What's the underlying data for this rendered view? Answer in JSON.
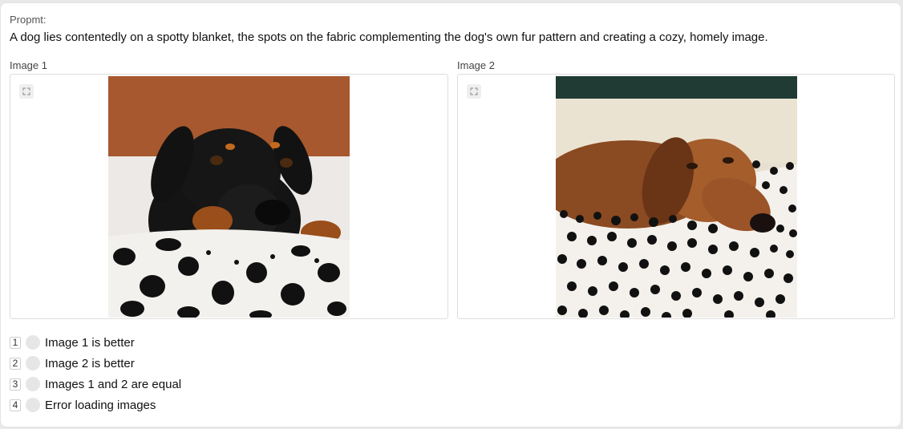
{
  "prompt": {
    "label": "Propmt:",
    "text": "A dog lies contentedly on a spotty blanket, the spots on the fabric complementing the dog's own fur pattern and creating a cozy, homely image."
  },
  "images": [
    {
      "label": "Image 1"
    },
    {
      "label": "Image 2"
    }
  ],
  "options": [
    {
      "key": "1",
      "label": "Image 1 is better"
    },
    {
      "key": "2",
      "label": "Image 2 is better"
    },
    {
      "key": "3",
      "label": "Images 1 and 2 are equal"
    },
    {
      "key": "4",
      "label": "Error loading images"
    }
  ]
}
